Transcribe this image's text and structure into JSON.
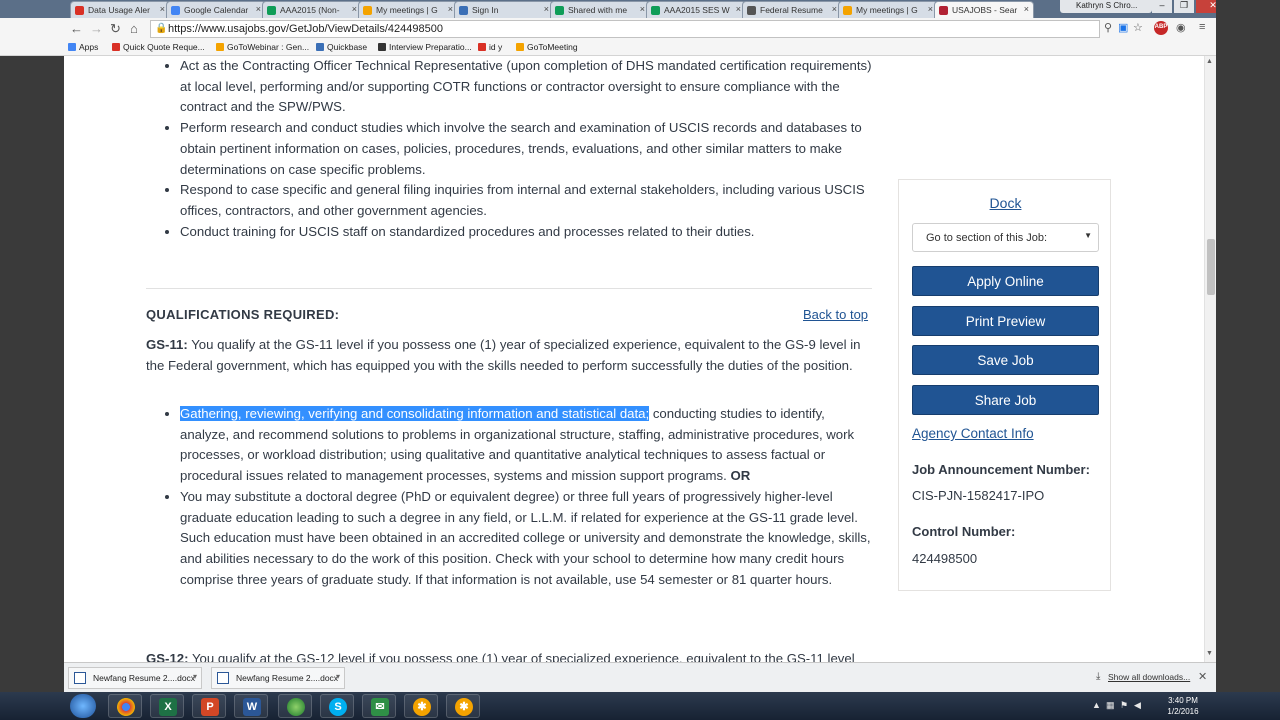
{
  "browser": {
    "tabs": [
      {
        "label": "Data Usage Aler",
        "color": "#d93025",
        "active": false
      },
      {
        "label": "Google Calendar",
        "color": "#4285f4",
        "active": false
      },
      {
        "label": "AAA2015 (Non-",
        "color": "#0f9d58",
        "active": false
      },
      {
        "label": "My meetings | G",
        "color": "#f4a300",
        "active": false
      },
      {
        "label": "Sign In",
        "color": "#3b6fb6",
        "active": false
      },
      {
        "label": "Shared with me",
        "color": "#0f9d58",
        "active": false
      },
      {
        "label": "AAA2015 SES W",
        "color": "#0f9d58",
        "active": false
      },
      {
        "label": "Federal Resume",
        "color": "#555555",
        "active": false
      },
      {
        "label": "My meetings | G",
        "color": "#f4a300",
        "active": false
      },
      {
        "label": "USAJOBS - Sear",
        "color": "#b22234",
        "active": true
      }
    ],
    "profile": "Kathryn S Chro...",
    "url": "https://www.usajobs.gov/GetJob/ViewDetails/424498500",
    "bookmarks": [
      {
        "label": "Apps",
        "color": "#4285f4"
      },
      {
        "label": "Quick Quote Reque...",
        "color": "#d93025"
      },
      {
        "label": "GoToWebinar : Gen...",
        "color": "#f4a300"
      },
      {
        "label": "Quickbase",
        "color": "#3b6fb6"
      },
      {
        "label": "Interview Preparatio...",
        "color": "#333333"
      },
      {
        "label": "id y",
        "color": "#d93025"
      },
      {
        "label": "GoToMeeting",
        "color": "#f4a300"
      }
    ]
  },
  "duties": [
    "Act as the Contracting Officer Technical Representative (upon completion of DHS mandated certification requirements) at local level, performing and/or supporting COTR functions or contractor oversight to ensure compliance with the contract and the SPW/PWS.",
    "Perform research and conduct studies which involve the search and examination of USCIS records and databases to obtain pertinent information on cases, policies, procedures, trends, evaluations, and other similar matters to make determinations on case specific problems.",
    "Respond to case specific and general filing inquiries from internal and external stakeholders, including various USCIS offices, contractors, and other government agencies.",
    "Conduct training for USCIS staff on standardized procedures and processes related to their duties."
  ],
  "qualifications": {
    "title": "QUALIFICATIONS REQUIRED:",
    "back_to_top": "Back to top",
    "gs11_label": "GS-11:",
    "gs11_text": " You qualify at the GS-11 level if you possess one (1) year of specialized experience, equivalent to the GS-9 level in the Federal government, which has equipped you with the skills needed to perform successfully the duties of the position.",
    "item1_highlight": "Gathering, reviewing, verifying and consolidating information and statistical data;",
    "item1_rest": " conducting studies to identify, analyze, and recommend solutions to problems in organizational structure, staffing, administrative procedures, work processes, or workload distribution; using qualitative and quantitative analytical techniques to assess factual or procedural issues related to management processes, systems and mission support programs. ",
    "item1_or": "OR",
    "item2": "You may substitute a doctoral degree (PhD or equivalent degree) or three full years of progressively higher-level graduate education leading to such a degree in any field, or L.L.M. if related for experience at the GS-11 grade level. Such education must have been obtained in an accredited college or university and demonstrate the knowledge, skills, and abilities necessary to do the work of this position. Check with your school to determine how many credit hours comprise three years of graduate study. If that information is not available, use 54 semester or 81 quarter hours.",
    "gs12_label": "GS-12:",
    "gs12_text": " You qualify at the GS-12 level if you possess one (1) year of specialized experience, equivalent to the GS-11 level"
  },
  "sidebar": {
    "dock": "Dock",
    "goto": "Go to section of this Job:",
    "apply": "Apply Online",
    "print": "Print Preview",
    "save": "Save Job",
    "share": "Share Job",
    "agency": "Agency Contact Info",
    "announcement_label": "Job Announcement Number:",
    "announcement_value": "CIS-PJN-1582417-IPO",
    "control_label": "Control Number:",
    "control_value": "424498500"
  },
  "downloads": {
    "items": [
      "Newfang Resume 2....docx",
      "Newfang Resume 2....docx"
    ],
    "show_all": "Show all downloads..."
  },
  "taskbar": {
    "time": "3:40 PM",
    "date": "1/2/2016"
  }
}
